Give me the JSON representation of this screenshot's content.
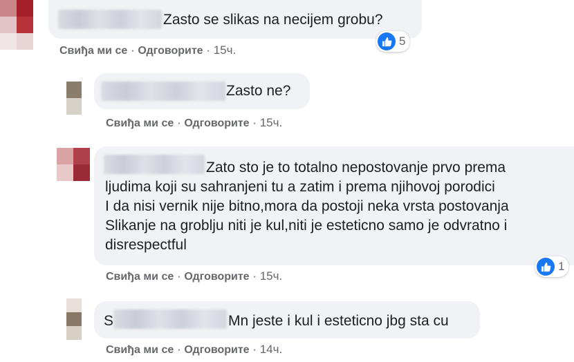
{
  "comments": [
    {
      "text": "Zasto se slikas na necijem grobu?",
      "actions": {
        "like": "Свиђа ми се",
        "sep1": "·",
        "reply": "Одговорите",
        "sep2": "·",
        "time": "15ч."
      },
      "reaction_count": "5"
    },
    {
      "text": "Zasto ne?",
      "actions": {
        "like": "Свиђа ми се",
        "sep1": "·",
        "reply": "Одговорите",
        "sep2": "·",
        "time": "15ч."
      }
    },
    {
      "lines": [
        "Zato sto je to totalno nepostovanje prvo prema",
        "ljudima koji su sahranjeni tu a zatim i prema njihovoj porodici",
        "I da nisi vernik nije bitno,mora da postoji neka vrsta postovanja",
        "Slikanje na groblju niti je kul,niti je esteticno samo je odvratno i",
        "disrespectful"
      ],
      "actions": {
        "like": "Свиђа ми се",
        "sep1": "·",
        "reply": "Одговорите",
        "sep2": "·",
        "time": "15ч."
      },
      "reaction_count": "1"
    },
    {
      "name_initial": "S",
      "text": "Mn jeste i kul i esteticno jbg sta cu",
      "actions": {
        "like": "Свиђа ми се",
        "sep1": "·",
        "reply": "Одговорите",
        "sep2": "·",
        "time": "14ч."
      }
    }
  ],
  "colors": {
    "bubble": "#f0f2f5",
    "meta_text": "#65676b",
    "like_blue": "#1877f2"
  },
  "icons": [
    "like-icon"
  ]
}
